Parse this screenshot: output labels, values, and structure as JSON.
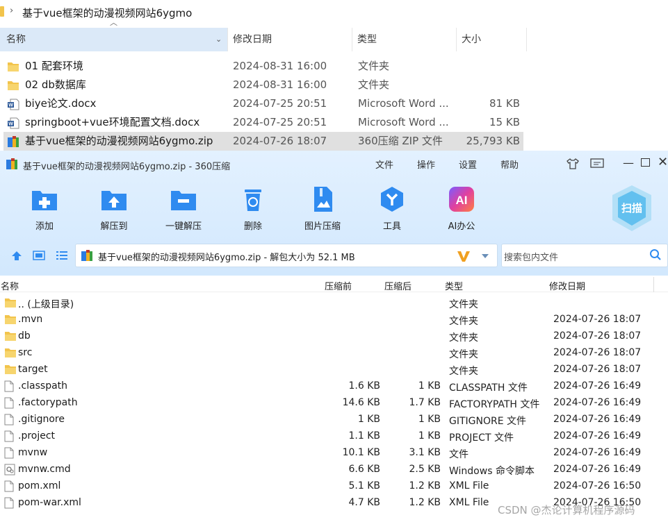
{
  "explorer": {
    "path": "基于vue框架的动漫视频网站6ygmo",
    "columns": {
      "name": "名称",
      "modified": "修改日期",
      "type": "类型",
      "size": "大小"
    },
    "rows": [
      {
        "name": "01 配套环境",
        "modified": "2024-08-31 16:00",
        "type": "文件夹",
        "size": "",
        "icon": "folder-icon"
      },
      {
        "name": "02 db数据库",
        "modified": "2024-08-31 16:00",
        "type": "文件夹",
        "size": "",
        "icon": "folder-icon"
      },
      {
        "name": "biye论文.docx",
        "modified": "2024-07-25 20:51",
        "type": "Microsoft Word ...",
        "size": "81 KB",
        "icon": "word-doc-icon"
      },
      {
        "name": "springboot+vue环境配置文档.docx",
        "modified": "2024-07-25 20:51",
        "type": "Microsoft Word ...",
        "size": "15 KB",
        "icon": "word-doc-icon"
      },
      {
        "name": "基于vue框架的动漫视频网站6ygmo.zip",
        "modified": "2024-07-26 18:07",
        "type": "360压缩 ZIP 文件",
        "size": "25,793 KB",
        "icon": "zip-archive-icon"
      }
    ]
  },
  "zip_window": {
    "title": "基于vue框架的动漫视频网站6ygmo.zip - 360压缩",
    "menu": [
      "文件",
      "操作",
      "设置",
      "帮助"
    ],
    "toolbar": [
      {
        "label": "添加",
        "icon": "add-icon"
      },
      {
        "label": "解压到",
        "icon": "extract-to-icon"
      },
      {
        "label": "一键解压",
        "icon": "one-click-extract-icon"
      },
      {
        "label": "删除",
        "icon": "delete-icon"
      },
      {
        "label": "图片压缩",
        "icon": "image-compress-icon"
      },
      {
        "label": "工具",
        "icon": "tools-icon"
      },
      {
        "label": "AI办公",
        "icon": "ai-office-icon"
      }
    ],
    "scan_label": "扫描",
    "ai_badge": "AI",
    "address": "基于vue框架的动漫视频网站6ygmo.zip - 解包大小为 52.1 MB",
    "search_placeholder": "搜索包内文件",
    "columns": {
      "name": "名称",
      "packed": "压缩前",
      "compressed": "压缩后",
      "type": "类型",
      "modified": "修改日期"
    },
    "files": [
      {
        "name": ".. (上级目录)",
        "packed": "",
        "compressed": "",
        "type": "文件夹",
        "modified": "",
        "icon": "folder-icon"
      },
      {
        "name": ".mvn",
        "packed": "",
        "compressed": "",
        "type": "文件夹",
        "modified": "2024-07-26 18:07",
        "icon": "folder-icon"
      },
      {
        "name": "db",
        "packed": "",
        "compressed": "",
        "type": "文件夹",
        "modified": "2024-07-26 18:07",
        "icon": "folder-icon"
      },
      {
        "name": "src",
        "packed": "",
        "compressed": "",
        "type": "文件夹",
        "modified": "2024-07-26 18:07",
        "icon": "folder-icon"
      },
      {
        "name": "target",
        "packed": "",
        "compressed": "",
        "type": "文件夹",
        "modified": "2024-07-26 18:07",
        "icon": "folder-icon"
      },
      {
        "name": ".classpath",
        "packed": "1.6 KB",
        "compressed": "1 KB",
        "type": "CLASSPATH 文件",
        "modified": "2024-07-26 16:49",
        "icon": "file-icon"
      },
      {
        "name": ".factorypath",
        "packed": "14.6 KB",
        "compressed": "1.7 KB",
        "type": "FACTORYPATH 文件",
        "modified": "2024-07-26 16:49",
        "icon": "file-icon"
      },
      {
        "name": ".gitignore",
        "packed": "1 KB",
        "compressed": "1 KB",
        "type": "GITIGNORE 文件",
        "modified": "2024-07-26 16:49",
        "icon": "file-icon"
      },
      {
        "name": ".project",
        "packed": "1.1 KB",
        "compressed": "1 KB",
        "type": "PROJECT 文件",
        "modified": "2024-07-26 16:49",
        "icon": "file-icon"
      },
      {
        "name": "mvnw",
        "packed": "10.1 KB",
        "compressed": "3.1 KB",
        "type": "文件",
        "modified": "2024-07-26 16:49",
        "icon": "file-icon"
      },
      {
        "name": "mvnw.cmd",
        "packed": "6.6 KB",
        "compressed": "2.5 KB",
        "type": "Windows 命令脚本",
        "modified": "2024-07-26 16:49",
        "icon": "cmd-script-icon"
      },
      {
        "name": "pom.xml",
        "packed": "5.1 KB",
        "compressed": "1.2 KB",
        "type": "XML File",
        "modified": "2024-07-26 16:50",
        "icon": "file-icon"
      },
      {
        "name": "pom-war.xml",
        "packed": "4.7 KB",
        "compressed": "1.2 KB",
        "type": "XML File",
        "modified": "2024-07-26 16:50",
        "icon": "file-icon"
      }
    ]
  },
  "watermark": "CSDN @杰论计算机程序源码",
  "colors": {
    "accent": "#2f8bf0",
    "header_bg": "#dbe9f8",
    "toolbar_bg": "#d9ecfe",
    "folder": "#f2c44c"
  }
}
